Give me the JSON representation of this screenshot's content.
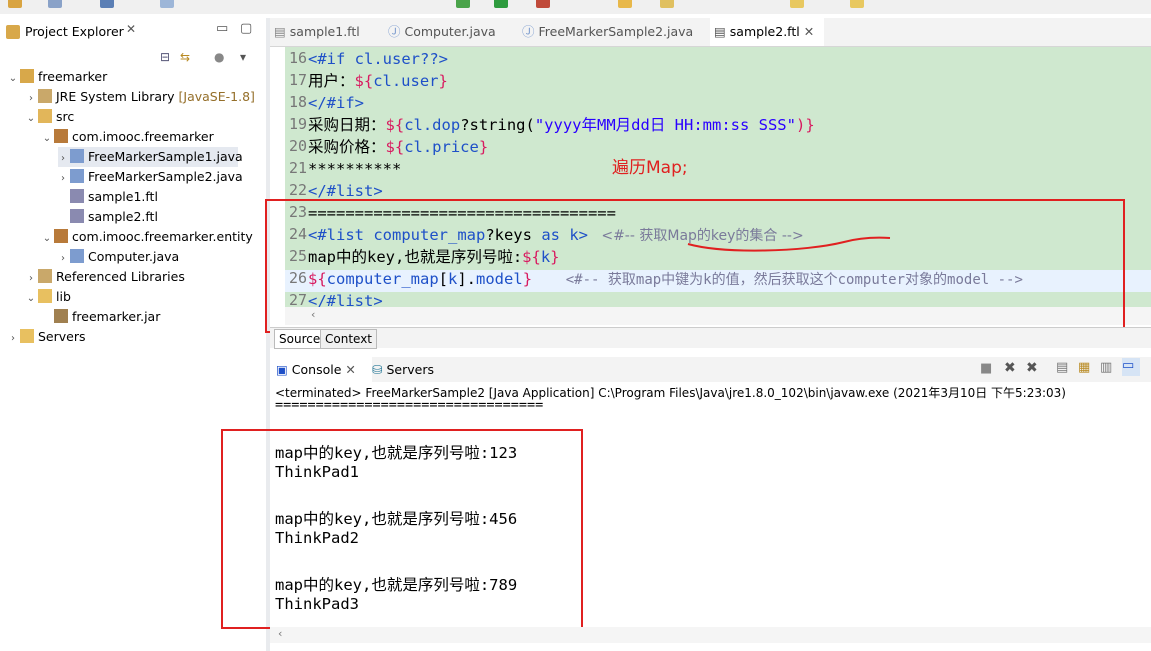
{
  "project_explorer": {
    "title": "Project Explorer",
    "tree": [
      {
        "label": "freemarker",
        "icon": "project-icon"
      },
      {
        "label": "JRE System Library",
        "suffix": "[JavaSE-1.8]",
        "icon": "library-icon"
      },
      {
        "label": "src",
        "icon": "source-folder-icon"
      },
      {
        "label": "com.imooc.freemarker",
        "icon": "package-icon"
      },
      {
        "label": "FreeMarkerSample1.java",
        "icon": "java-file-icon"
      },
      {
        "label": "FreeMarkerSample2.java",
        "icon": "java-file-icon"
      },
      {
        "label": "sample1.ftl",
        "icon": "ftl-file-icon"
      },
      {
        "label": "sample2.ftl",
        "icon": "ftl-file-icon"
      },
      {
        "label": "com.imooc.freemarker.entity",
        "icon": "package-icon"
      },
      {
        "label": "Computer.java",
        "icon": "java-file-icon"
      },
      {
        "label": "Referenced Libraries",
        "icon": "library-icon"
      },
      {
        "label": "lib",
        "icon": "folder-icon"
      },
      {
        "label": "freemarker.jar",
        "icon": "jar-icon"
      },
      {
        "label": "Servers",
        "icon": "folder-icon"
      }
    ]
  },
  "editor": {
    "tabs": [
      "sample1.ftl",
      "Computer.java",
      "FreeMarkerSample2.java",
      "sample2.ftl"
    ],
    "active_tab": "sample2.ftl",
    "line_numbers": [
      "16",
      "17",
      "18",
      "19",
      "20",
      "21",
      "22",
      "23",
      "24",
      "25",
      "26",
      "27"
    ],
    "lines": {
      "l16a": "<#if ",
      "l16b": "cl.user",
      "l16c": "??>",
      "l17a": "用户：",
      "l17b": "${",
      "l17c": "cl.user",
      "l17d": "}",
      "l18a": "</#if>",
      "l19a": "采购日期：",
      "l19b": "${",
      "l19c": "cl.dop",
      "l19d": "?string(",
      "l19e": "\"yyyy年MM月dd日 HH:mm:ss SSS\"",
      "l19f": ")}",
      "l20a": "采购价格：",
      "l20b": "${",
      "l20c": "cl.price",
      "l20d": "}",
      "l21a": "**********",
      "l22a": "</#list>",
      "l23a": "=================================",
      "l24a": "<#list ",
      "l24b": "computer_map",
      "l24c": "?keys ",
      "l24d": "as ",
      "l24e": "k",
      "l24f": ">",
      "l24g": "   <#-- 获取Map的key的集合 -->",
      "l25a": "map中的key,也就是序列号啦:",
      "l25b": "${",
      "l25c": "k",
      "l25d": "}",
      "l26a": "${",
      "l26b": "computer_map",
      "l26c": "[",
      "l26d": "k",
      "l26e": "].",
      "l26f": "model",
      "l26g": "}",
      "l26h": "    <#-- 获取map中键为k的值，然后获取这个computer对象的model -->",
      "l27a": "</#list>"
    },
    "bottom_tabs": [
      "Source",
      "Context"
    ],
    "annotation": "遍历Map;"
  },
  "console": {
    "tabs": [
      "Console",
      "Servers"
    ],
    "status": "<terminated> FreeMarkerSample2 [Java Application] C:\\Program Files\\Java\\jre1.8.0_102\\bin\\javaw.exe (2021年3月10日 下午5:23:03)",
    "separator": "=================================",
    "output": [
      "map中的key,也就是序列号啦:123",
      "ThinkPad1",
      "map中的key,也就是序列号啦:456",
      "ThinkPad2",
      "map中的key,也就是序列号啦:789",
      "ThinkPad3"
    ]
  },
  "colors": {
    "annotation": "#e02020",
    "editor_bg": "#cfe8cf",
    "keyword": "#1e50c8",
    "dollar": "#d81b60"
  }
}
